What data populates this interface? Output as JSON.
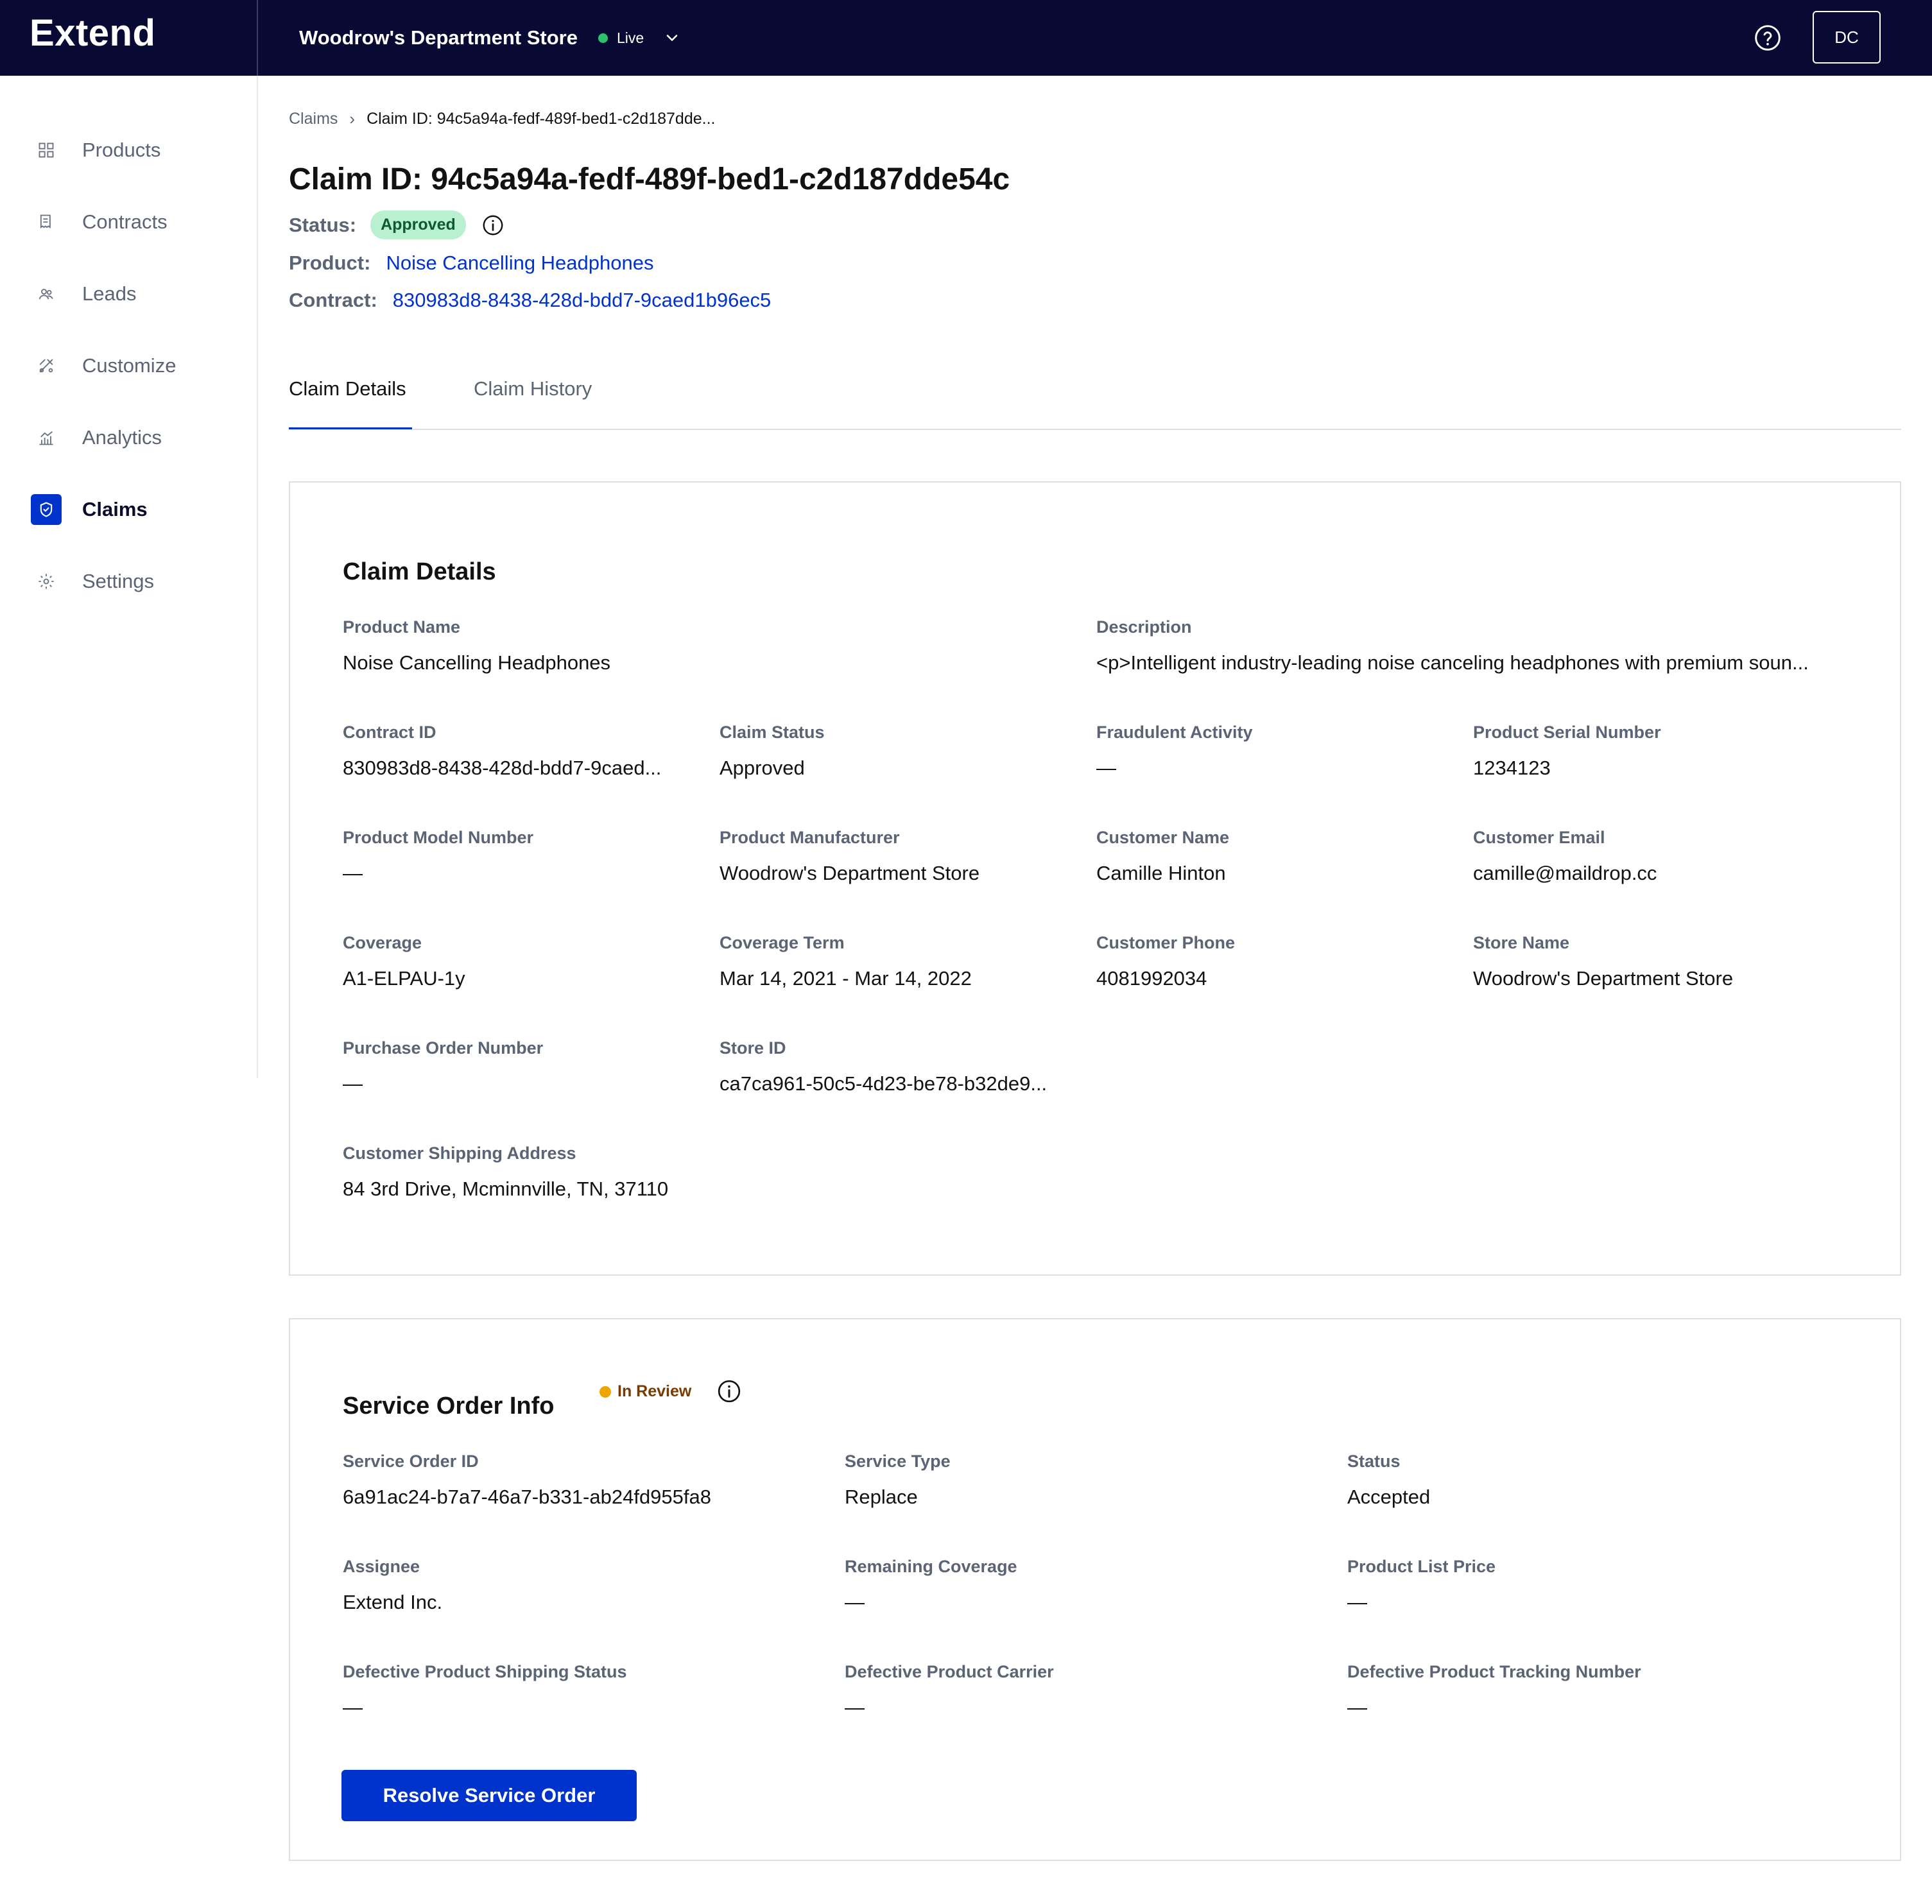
{
  "brand": "Extend",
  "store": {
    "name": "Woodrow's Department Store",
    "env": "Live"
  },
  "user": {
    "initials": "DC"
  },
  "sidebar": {
    "items": [
      {
        "label": "Products",
        "icon": "grid-icon"
      },
      {
        "label": "Contracts",
        "icon": "receipt-icon"
      },
      {
        "label": "Leads",
        "icon": "people-icon"
      },
      {
        "label": "Customize",
        "icon": "tools-icon"
      },
      {
        "label": "Analytics",
        "icon": "bar-chart-icon"
      },
      {
        "label": "Claims",
        "icon": "shield-icon",
        "active": true
      },
      {
        "label": "Settings",
        "icon": "gear-icon"
      }
    ]
  },
  "breadcrumb": {
    "root": "Claims",
    "current": "Claim ID: 94c5a94a-fedf-489f-bed1-c2d187dde..."
  },
  "claim": {
    "title": "Claim ID: 94c5a94a-fedf-489f-bed1-c2d187dde54c",
    "status_label": "Status:",
    "status": "Approved",
    "product_label": "Product:",
    "product": "Noise Cancelling Headphones",
    "contract_label": "Contract:",
    "contract": "830983d8-8438-428d-bdd7-9caed1b96ec5"
  },
  "tabs": [
    "Claim Details",
    "Claim History"
  ],
  "claim_details": {
    "title": "Claim Details",
    "fields": [
      {
        "label": "Product Name",
        "value": "Noise Cancelling Headphones"
      },
      {
        "label": "Description",
        "value": "<p>Intelligent industry-leading noise canceling headphones with premium soun..."
      },
      {
        "label": "Contract ID",
        "value": "830983d8-8438-428d-bdd7-9caed..."
      },
      {
        "label": "Claim Status",
        "value": "Approved"
      },
      {
        "label": "Fraudulent Activity",
        "value": "—"
      },
      {
        "label": "Product Serial Number",
        "value": "1234123"
      },
      {
        "label": "Product Model Number",
        "value": "—"
      },
      {
        "label": "Product Manufacturer",
        "value": "Woodrow's Department Store"
      },
      {
        "label": "Customer Name",
        "value": "Camille Hinton"
      },
      {
        "label": "Customer Email",
        "value": "camille@maildrop.cc"
      },
      {
        "label": "Coverage",
        "value": "A1-ELPAU-1y"
      },
      {
        "label": "Coverage Term",
        "value": "Mar 14, 2021 - Mar 14, 2022"
      },
      {
        "label": "Customer Phone",
        "value": "4081992034"
      },
      {
        "label": "Store Name",
        "value": "Woodrow's Department Store"
      },
      {
        "label": "Purchase Order Number",
        "value": "—"
      },
      {
        "label": "Store ID",
        "value": "ca7ca961-50c5-4d23-be78-b32de9..."
      },
      {
        "label": "Customer Shipping Address",
        "value": "84 3rd Drive, Mcminnville, TN, 37110"
      }
    ]
  },
  "service_order": {
    "title": "Service Order Info",
    "status_badge": "In Review",
    "fields": [
      {
        "label": "Service Order ID",
        "value": "6a91ac24-b7a7-46a7-b331-ab24fd955fa8"
      },
      {
        "label": "Service Type",
        "value": "Replace"
      },
      {
        "label": "Status",
        "value": "Accepted"
      },
      {
        "label": "Assignee",
        "value": "Extend Inc."
      },
      {
        "label": "Remaining Coverage",
        "value": "—"
      },
      {
        "label": "Product List Price",
        "value": "—"
      },
      {
        "label": "Defective Product Shipping Status",
        "value": "—"
      },
      {
        "label": "Defective Product Carrier",
        "value": "—"
      },
      {
        "label": "Defective Product Tracking Number",
        "value": "—"
      }
    ],
    "resolve_label": "Resolve Service Order"
  },
  "colors": {
    "topbar": "#090a33",
    "accent": "#0033cc",
    "approved_bg": "#b8f0d0",
    "live": "#2bc36b",
    "in_review": "#f0a400"
  }
}
